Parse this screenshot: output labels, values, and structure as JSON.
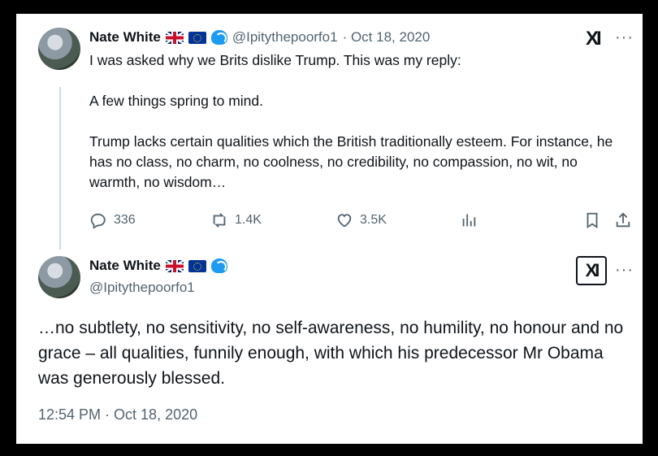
{
  "tweet1": {
    "name": "Nate White",
    "handle": "@Ipitythepoorfo1",
    "date": "· Oct 18, 2020",
    "text": "I was asked why we Brits dislike Trump. This was my reply:\n\nA few things spring to mind.\n\nTrump lacks certain qualities which the British traditionally esteem. For instance, he has no class, no charm, no coolness, no credibility, no compassion, no wit, no warmth, no wisdom…",
    "replies": "336",
    "reposts": "1.4K",
    "likes": "3.5K"
  },
  "tweet2": {
    "name": "Nate White",
    "handle": "@Ipitythepoorfo1",
    "text": "…no subtlety, no sensitivity, no self-awareness, no humility, no honour and no grace – all qualities, funnily enough, with which his predecessor Mr Obama was generously blessed.",
    "timestamp": "12:54 PM · Oct 18, 2020"
  },
  "icons": {
    "grok": "XI",
    "more": "···"
  },
  "colors": {
    "text": "#0f1419",
    "muted": "#536471",
    "background": "#000000",
    "card": "#ffffff"
  }
}
